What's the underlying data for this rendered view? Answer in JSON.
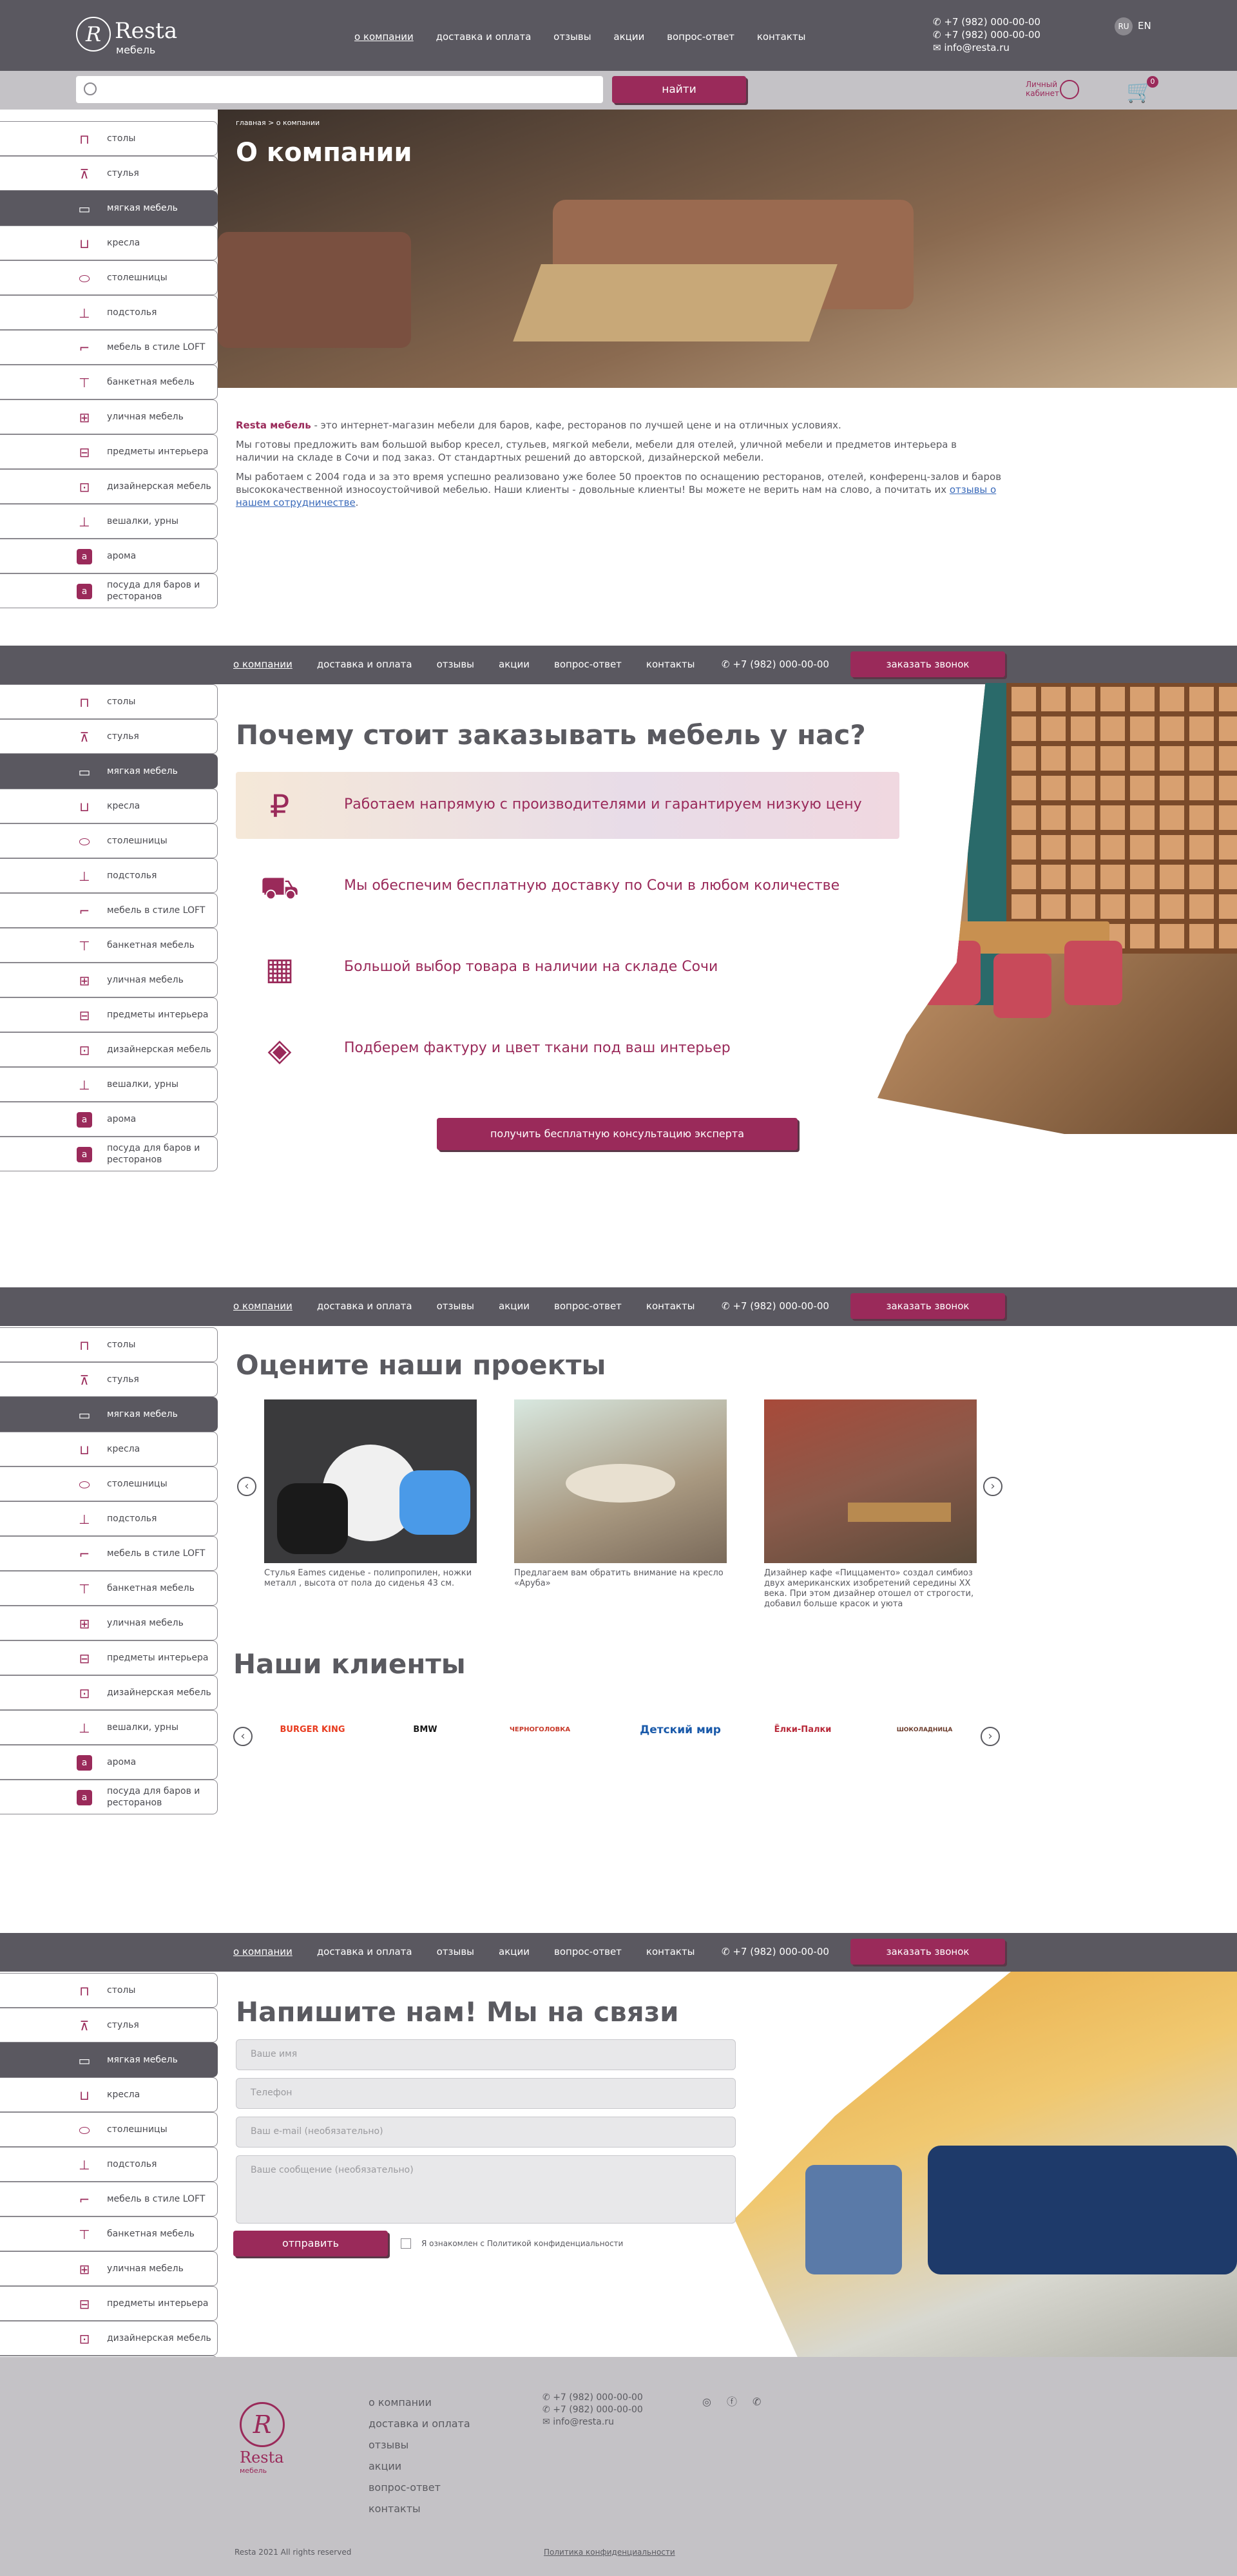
{
  "header": {
    "logo_name": "Resta",
    "logo_sub": "мебель",
    "logo_mark": "R",
    "nav": [
      "о компании",
      "доставка и оплата",
      "отзывы",
      "акции",
      "вопрос-ответ",
      "контакты"
    ],
    "phone1": "+7 (982) 000-00-00",
    "phone2": "+7 (982) 000-00-00",
    "email": "info@resta.ru",
    "lang_ru": "RU",
    "lang_en": "EN"
  },
  "search": {
    "placeholder": "",
    "button": "найти",
    "cabinet": "Личный\nкабинет",
    "cart_count": "0"
  },
  "sidebar": {
    "items": [
      {
        "label": "столы",
        "icon": "table-icon",
        "glyph": "⊓"
      },
      {
        "label": "стулья",
        "icon": "chairs-icon",
        "glyph": "⊼"
      },
      {
        "label": "мягкая мебель",
        "icon": "sofa-icon",
        "glyph": "▭"
      },
      {
        "label": "кресла",
        "icon": "armchair-icon",
        "glyph": "⊔"
      },
      {
        "label": "столешницы",
        "icon": "tabletop-icon",
        "glyph": "⬭"
      },
      {
        "label": "подстолья",
        "icon": "table-base-icon",
        "glyph": "⊥"
      },
      {
        "label": "мебель в стиле LOFT",
        "icon": "loft-icon",
        "glyph": "⌐"
      },
      {
        "label": "банкетная мебель",
        "icon": "banquet-icon",
        "glyph": "⊤"
      },
      {
        "label": "уличная мебель",
        "icon": "outdoor-icon",
        "glyph": "⊞"
      },
      {
        "label": "предметы интерьера",
        "icon": "interior-icon",
        "glyph": "⊟"
      },
      {
        "label": "дизайнерская мебель",
        "icon": "designer-icon",
        "glyph": "⊡"
      },
      {
        "label": "вешалки, урны",
        "icon": "hanger-icon",
        "glyph": "⊥"
      },
      {
        "label": "арома",
        "icon": "aroma-icon",
        "glyph": "a"
      },
      {
        "label": "посуда для баров и ресторанов",
        "icon": "tableware-icon",
        "glyph": "a"
      }
    ]
  },
  "hero": {
    "breadcrumb": "главная > о компании",
    "title": "О компании"
  },
  "about": {
    "brand": "Resta мебель",
    "p1_rest": " - это интернет-магазин мебели для баров, кафе, ресторанов по лучшей цене и на отличных условиях.",
    "p2": "Мы готовы предложить вам большой выбор кресел, стульев, мягкой мебели, мебели для отелей, уличной мебели и предметов интерьера  в наличии на складе в Сочи и под заказ. От стандартных решений до авторской, дизайнерской мебели.",
    "p3": "Мы работаем с 2004 года и за это время успешно реализовано уже более 50 проектов по оснащению ресторанов, отелей, конференц-залов и баров высококачественной износоустойчивой мебелью. Наши клиенты - довольные клиенты! Вы можете не верить нам на слово, а почитать их",
    "p3_link": "отзывы о нашем сотрудничестве",
    "p3_end": "."
  },
  "secbar": {
    "nav": [
      "о компании",
      "доставка и оплата",
      "отзывы",
      "акции",
      "вопрос-ответ",
      "контакты"
    ],
    "phone": "+7 (982) 000-00-00",
    "call": "заказать звонок"
  },
  "why": {
    "title": "Почему стоит заказывать мебель у нас?",
    "items": [
      {
        "text": "Работаем напрямую с производителями и гарантируем низкую цену",
        "icon": "money-bag-icon",
        "glyph": "₽"
      },
      {
        "text": "Мы обеспечим бесплатную доставку по Сочи в любом количестве",
        "icon": "truck-icon",
        "glyph": "⛟"
      },
      {
        "text": "Большой выбор товара в наличии на складе Сочи",
        "icon": "warehouse-icon",
        "glyph": "▦"
      },
      {
        "text": "Подберем фактуру и цвет ткани под ваш интерьер",
        "icon": "fabric-swatch-icon",
        "glyph": "◈"
      }
    ],
    "consult": "получить бесплатную консультацию эксперта"
  },
  "projects": {
    "title": "Оцените наши проекты",
    "items": [
      {
        "caption": "Стулья Eames сиденье  - полипропилен, ножки металл , высота от пола до сиденья 43 см."
      },
      {
        "caption": "Предлагаем вам обратить внимание на кресло «Аруба»"
      },
      {
        "caption": "Дизайнер кафе «Пиццаменто» создал симбиоз двух американских изобретений середины XX века. При этом дизайнер отошел от строгости, добавил больше красок и уюта"
      }
    ]
  },
  "clients": {
    "title": "Наши клиенты",
    "logos": [
      {
        "name": "BURGER KING",
        "icon": "burger-king-logo",
        "color": "#e83a1e"
      },
      {
        "name": "BMW",
        "icon": "bmw-logo",
        "color": "#1a1a1a"
      },
      {
        "name": "ЧЕРНОГОЛОВКА",
        "icon": "chernogolovka-logo",
        "color": "#c83a2a"
      },
      {
        "name": "Детский мир",
        "icon": "detsky-mir-logo",
        "color": "#1a5aaa"
      },
      {
        "name": "Ёлки-Палки",
        "icon": "elki-palki-logo",
        "color": "#b82a3a"
      },
      {
        "name": "ШОКОЛАДНИЦА",
        "icon": "shokoladnitsa-logo",
        "color": "#6a3a2a"
      }
    ]
  },
  "contact": {
    "title": "Напишите нам! Мы на связи",
    "name_ph": "Ваше имя",
    "phone_ph": "Телефон",
    "email_ph": "Ваш e-mail (необязательно)",
    "msg_ph": "Ваше сообщение (необязательно)",
    "send": "отправить",
    "consent": "Я ознакомлен с Политикой конфиденциальности"
  },
  "footer": {
    "logo_name": "Resta",
    "logo_sub": "мебель",
    "nav": [
      "о компании",
      "доставка и оплата",
      "отзывы",
      "акции",
      "вопрос-ответ",
      "контакты"
    ],
    "phone1": "+7 (982) 000-00-00",
    "phone2": "+7 (982) 000-00-00",
    "email": "info@resta.ru",
    "copyright": "Resta 2021 All rights reserved",
    "privacy": "Политика конфиденциальности"
  },
  "colors": {
    "accent": "#9a2a5a",
    "dark": "#5a5860",
    "light": "#c4c2c6"
  }
}
